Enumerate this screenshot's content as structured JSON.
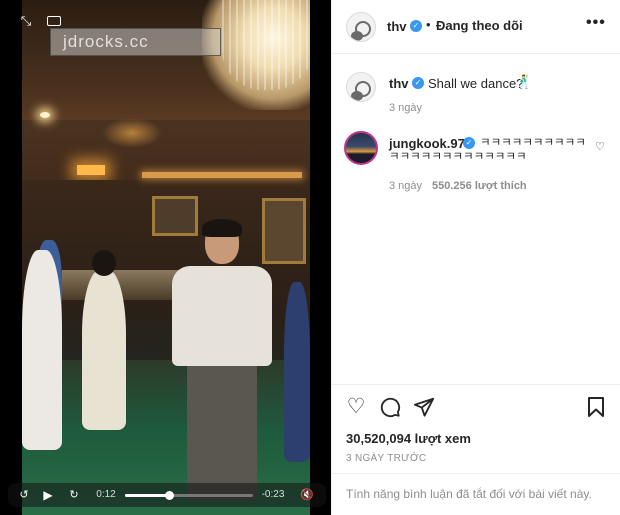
{
  "video": {
    "watermark": "jdrocks.cc",
    "current_time": "0:12",
    "remaining_time": "-0:23",
    "progress": 0.34
  },
  "post": {
    "author": "thv",
    "follow_status": "Đang theo dõi",
    "caption_author": "thv",
    "caption_text": "Shall we dance?",
    "caption_time": "3 ngày",
    "comment": {
      "author": "jungkook.97",
      "text": "ㅋㅋㅋㅋㅋㅋㅋㅋㅋㅋㅋㅋㅋㅋㅋㅋㅋㅋㅋㅋㅋㅋㅋ",
      "time": "3 ngày",
      "likes": "550.256 lượt thích"
    },
    "views": "30,520,094 lượt xem",
    "posted_ago": "3 NGÀY TRƯỚC",
    "comments_disabled": "Tính năng bình luận đã tắt đối với bài viết này."
  },
  "icons": {
    "expand": "expand-icon",
    "captions": "captions-icon",
    "rewind": "rewind-10-icon",
    "play": "play-icon",
    "forward": "forward-10-icon",
    "mute": "muted-speaker-icon",
    "more": "more-options-icon",
    "verified": "verified-badge-icon",
    "like": "heart-icon",
    "comment": "comment-icon",
    "share": "share-icon",
    "save": "bookmark-icon"
  },
  "colors": {
    "verified": "#3897f0",
    "text": "#262626",
    "muted": "#8e8e8e"
  }
}
